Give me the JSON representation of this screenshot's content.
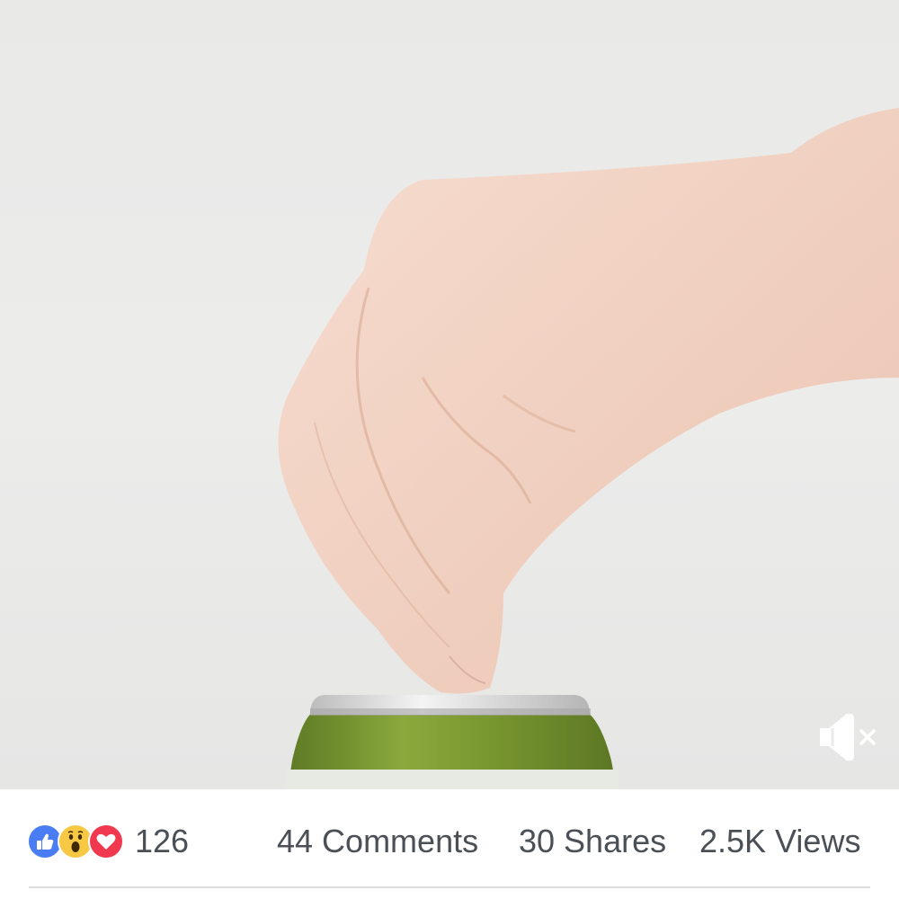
{
  "video": {
    "muted": true,
    "mute_icon": "speaker-muted-icon"
  },
  "reactions": {
    "icons": [
      "like-icon",
      "wow-icon",
      "love-icon"
    ],
    "colors": {
      "like": "#4a7cf3",
      "wow": "#f7c844",
      "love": "#f0394f"
    },
    "count": "126"
  },
  "stats": {
    "comments": "44 Comments",
    "shares": "30 Shares",
    "views": "2.5K Views"
  }
}
